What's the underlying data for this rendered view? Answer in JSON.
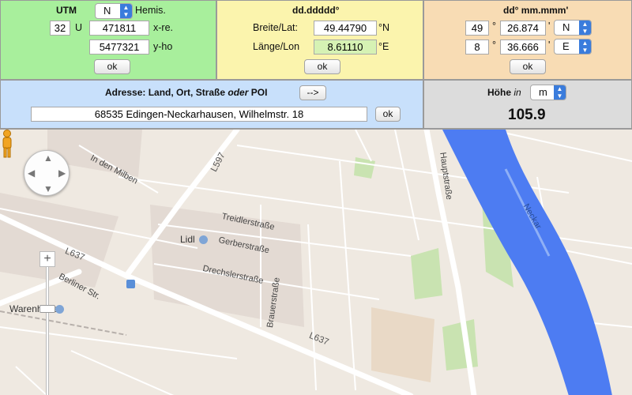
{
  "utm": {
    "title": "UTM",
    "hemisphere_value": "N",
    "hemisphere_label": "Hemis.",
    "zone": "32",
    "band": "U",
    "easting": "471811",
    "easting_label": "x-re.",
    "northing": "5477321",
    "northing_label": "y-ho",
    "ok_label": "ok"
  },
  "decimal": {
    "title": "dd.ddddd°",
    "lat_label": "Breite/Lat:",
    "lat_value": "49.44790",
    "lat_unit": "°N",
    "lon_label": "Länge/Lon",
    "lon_value": "8.61110",
    "lon_unit": "°E",
    "ok_label": "ok"
  },
  "dms": {
    "title": "dd° mm.mmm'",
    "lat_deg": "49",
    "lat_min": "26.874",
    "lat_dir": "N",
    "lon_deg": "8",
    "lon_min": "36.666",
    "lon_dir": "E",
    "deg_sym": "°",
    "min_sym": "'",
    "ok_label": "ok"
  },
  "address": {
    "title_prefix": "Adresse: Land, Ort, Straße ",
    "title_or": "oder",
    "title_suffix": "  POI",
    "arrow_button": "-->",
    "value": "68535 Edingen-Neckarhausen, Wilhelmstr. 18",
    "ok_label": "ok"
  },
  "height": {
    "title_prefix": "Höhe ",
    "title_in": "in",
    "unit": "m",
    "value": "105.9"
  },
  "map": {
    "streets": {
      "in_den_milben": "In den Milben",
      "l597": "L597",
      "l637_left": "L637",
      "l637_bottom": "L637",
      "berliner": "Berliner Str.",
      "treidler": "Treidlerstraße",
      "gerber": "Gerberstraße",
      "drechsler": "Drechslerstraße",
      "brauer": "Brauerstraße",
      "haupt": "Hauptstraße",
      "neckar": "Neckar",
      "lidl": "Lidl",
      "warenhaus": "Warenhaus"
    },
    "zoom_plus": "+",
    "colors": {
      "river": "#4d7cf2",
      "road": "#ffffff",
      "block": "#ddd3cc",
      "green": "#c9e3b1"
    }
  }
}
